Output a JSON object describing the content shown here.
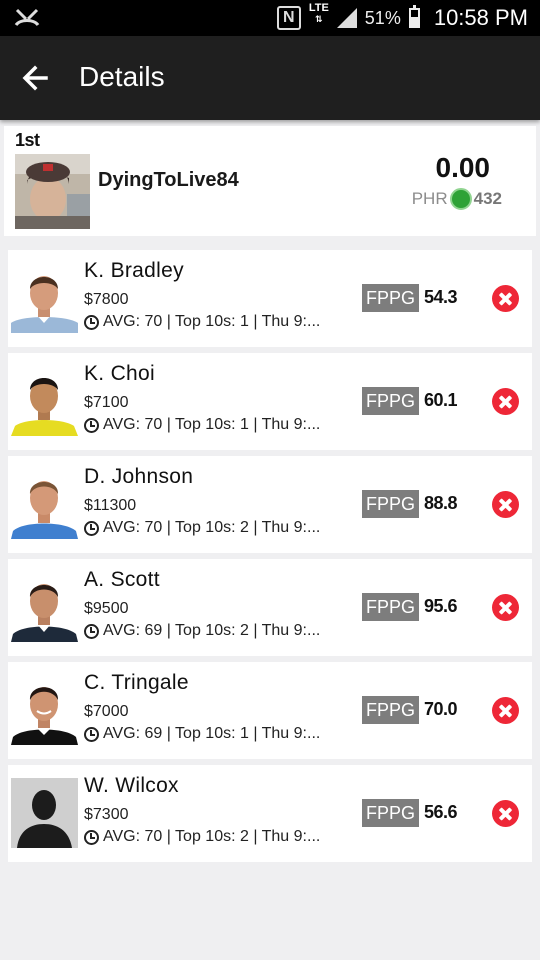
{
  "status_bar": {
    "notification_icon": "cross-arrows-icon",
    "nfc": "N",
    "network": "LTE",
    "battery_pct": "51%",
    "time": "10:58 PM"
  },
  "header": {
    "title": "Details",
    "back_icon": "arrow-left-icon"
  },
  "entry": {
    "rank": "1st",
    "username": "DyingToLive84",
    "score": "0.00",
    "phr_label": "PHR",
    "phr_status_color": "#2ea236",
    "phr_value": "432"
  },
  "players": [
    {
      "name": "K. Bradley",
      "salary": "$7800",
      "stats": "AVG: 70 | Top 10s: 1 | Thu 9:...",
      "fppg_label": "FPPG",
      "fppg": "54.3"
    },
    {
      "name": "K. Choi",
      "salary": "$7100",
      "stats": "AVG: 70 | Top 10s: 1 | Thu 9:...",
      "fppg_label": "FPPG",
      "fppg": "60.1"
    },
    {
      "name": "D. Johnson",
      "salary": "$11300",
      "stats": "AVG: 70 | Top 10s: 2 | Thu 9:...",
      "fppg_label": "FPPG",
      "fppg": "88.8"
    },
    {
      "name": "A. Scott",
      "salary": "$9500",
      "stats": "AVG: 69 | Top 10s: 2 | Thu 9:...",
      "fppg_label": "FPPG",
      "fppg": "95.6"
    },
    {
      "name": "C. Tringale",
      "salary": "$7000",
      "stats": "AVG: 69 | Top 10s: 1 | Thu 9:...",
      "fppg_label": "FPPG",
      "fppg": "70.0"
    },
    {
      "name": "W. Wilcox",
      "salary": "$7300",
      "stats": "AVG: 70 | Top 10s: 2 | Thu 9:...",
      "fppg_label": "FPPG",
      "fppg": "56.6"
    }
  ],
  "colors": {
    "remove_button": "#ee2737",
    "fppg_badge": "#7d7d7d",
    "app_bar": "#1f1f1f"
  }
}
